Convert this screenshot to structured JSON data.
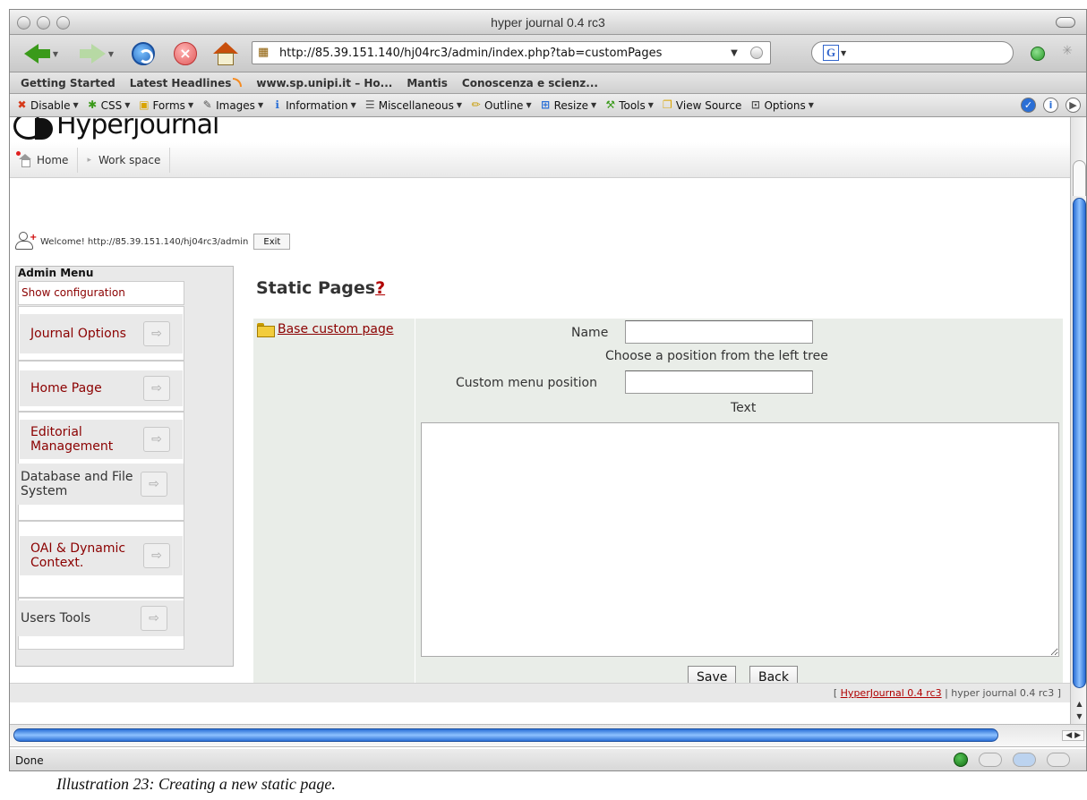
{
  "window": {
    "title": "hyper journal 0.4 rc3"
  },
  "navbar": {
    "url": "http://85.39.151.140/hj04rc3/admin/index.php?tab=customPages",
    "search_engine_letter": "G"
  },
  "bookmarks": [
    "Getting Started",
    "Latest Headlines",
    "www.sp.unipi.it – Ho...",
    "Mantis",
    "Conoscenza e scienz..."
  ],
  "devbar": {
    "items": [
      {
        "label": "Disable",
        "icon": "disable-icon",
        "glyph": "✖",
        "color": "#d63a1a"
      },
      {
        "label": "CSS",
        "icon": "css-icon",
        "glyph": "✱",
        "color": "#3a9a1a"
      },
      {
        "label": "Forms",
        "icon": "forms-icon",
        "glyph": "▣",
        "color": "#d9a400"
      },
      {
        "label": "Images",
        "icon": "images-icon",
        "glyph": "✎",
        "color": "#555555"
      },
      {
        "label": "Information",
        "icon": "information-icon",
        "glyph": "ℹ",
        "color": "#2a6fd6"
      },
      {
        "label": "Miscellaneous",
        "icon": "miscellaneous-icon",
        "glyph": "☰",
        "color": "#555555"
      },
      {
        "label": "Outline",
        "icon": "outline-icon",
        "glyph": "✏",
        "color": "#c89a00"
      },
      {
        "label": "Resize",
        "icon": "resize-icon",
        "glyph": "⊞",
        "color": "#2a6fd6"
      },
      {
        "label": "Tools",
        "icon": "tools-icon",
        "glyph": "⚒",
        "color": "#3a9a1a"
      },
      {
        "label": "View Source",
        "icon": "view-source-icon",
        "glyph": "❐",
        "color": "#d9a400"
      },
      {
        "label": "Options",
        "icon": "options-icon",
        "glyph": "⊡",
        "color": "#555555"
      }
    ]
  },
  "site": {
    "logo_text": "Hyperjournal",
    "nav": {
      "home": "Home",
      "workspace": "Work space"
    },
    "welcome": "Welcome! http://85.39.151.140/hj04rc3/admin",
    "exit": "Exit"
  },
  "admin_menu": {
    "title": "Admin Menu",
    "show_configuration": "Show configuration",
    "items": [
      {
        "label": "Journal Options",
        "dark": false
      },
      {
        "label": "Home Page",
        "dark": false
      },
      {
        "label": "Editorial Management",
        "dark": false
      },
      {
        "label": "Database and File System",
        "dark": true
      },
      {
        "label": "OAI & Dynamic Context.",
        "dark": false
      },
      {
        "label": "Users Tools",
        "dark": true
      }
    ]
  },
  "main": {
    "title": "Static Pages",
    "help": "?",
    "tree_item": "Base custom page",
    "name_label": "Name",
    "name_value": "",
    "hint": "Choose a position from the left tree",
    "position_label": "Custom menu position",
    "position_value": "",
    "text_label": "Text",
    "text_value": "",
    "save": "Save",
    "back": "Back"
  },
  "footer": {
    "open": "[ ",
    "link": "HyperJournal 0.4 rc3",
    "rest": " | hyper journal 0.4 rc3 ]"
  },
  "status": "Done",
  "caption": "Illustration 23: Creating a new static page."
}
